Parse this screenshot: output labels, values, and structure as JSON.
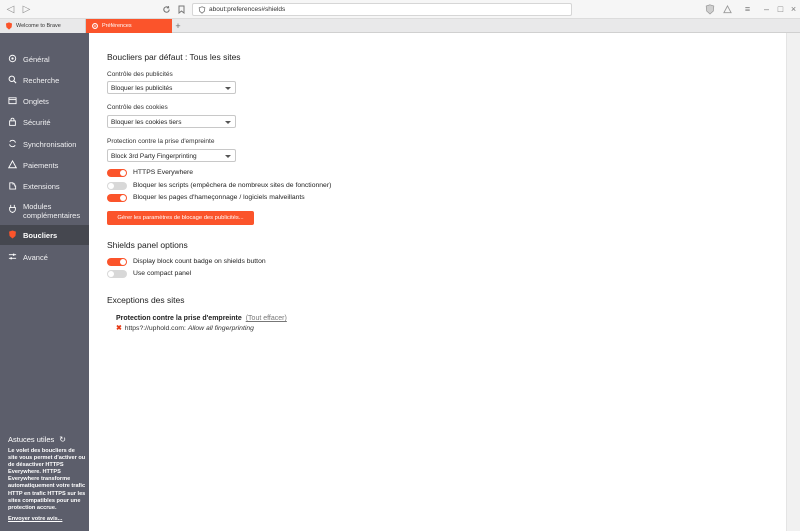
{
  "browser": {
    "url": "about:preferences#shields",
    "tabs": [
      {
        "label": "Welcome to Brave"
      },
      {
        "label": "Préférences"
      }
    ]
  },
  "sidebar": {
    "items": [
      {
        "label": "Général",
        "icon": "general-icon"
      },
      {
        "label": "Recherche",
        "icon": "search-icon"
      },
      {
        "label": "Onglets",
        "icon": "tabs-icon"
      },
      {
        "label": "Sécurité",
        "icon": "lock-icon"
      },
      {
        "label": "Synchronisation",
        "icon": "sync-icon"
      },
      {
        "label": "Paiements",
        "icon": "payments-icon"
      },
      {
        "label": "Extensions",
        "icon": "extensions-icon"
      },
      {
        "label": "Modules complémentaires",
        "line1": "Modules",
        "line2": "complémentaires",
        "icon": "plugins-icon"
      },
      {
        "label": "Boucliers",
        "icon": "shield-icon",
        "active": true
      },
      {
        "label": "Avancé",
        "icon": "sliders-icon"
      }
    ],
    "tips": {
      "title": "Astuces utiles",
      "body": "Le volet des boucliers de site vous permet d'activer ou de désactiver HTTPS Everywhere. HTTPS Everywhere transforme automatiquement votre trafic HTTP en trafic HTTPS sur les sites compatibles pour une protection accrue.",
      "link": "Envoyer votre avis..."
    }
  },
  "main": {
    "default_shields": {
      "title": "Boucliers par défaut : Tous les sites",
      "ads": {
        "label": "Contrôle des publicités",
        "value": "Bloquer les publicités"
      },
      "cookies": {
        "label": "Contrôle des cookies",
        "value": "Bloquer les cookies tiers"
      },
      "fingerprint": {
        "label": "Protection contre la prise d'empreinte",
        "value": "Block 3rd Party Fingerprinting"
      },
      "toggles": [
        {
          "label": "HTTPS Everywhere",
          "on": true
        },
        {
          "label": "Bloquer les scripts (empêchera de nombreux sites de fonctionner)",
          "on": false
        },
        {
          "label": "Bloquer les pages d'hameçonnage / logiciels malveillants",
          "on": true
        }
      ],
      "manage_button": "Gérer les paramètres de blocage des publicités..."
    },
    "panel_options": {
      "title": "Shields panel options",
      "toggles": [
        {
          "label": "Display block count badge on shields button",
          "on": true
        },
        {
          "label": "Use compact panel",
          "on": false
        }
      ]
    },
    "exceptions": {
      "title": "Exceptions des sites",
      "heading": "Protection contre la prise d'empreinte",
      "clear_link": "(Tout effacer)",
      "entries": [
        {
          "site": "https?://uphold.com:",
          "rule": "Allow all fingerprinting"
        }
      ]
    }
  },
  "colors": {
    "accent": "#fb542b",
    "sidebar": "#5c5e6b",
    "sidebar_active": "#45474f"
  }
}
